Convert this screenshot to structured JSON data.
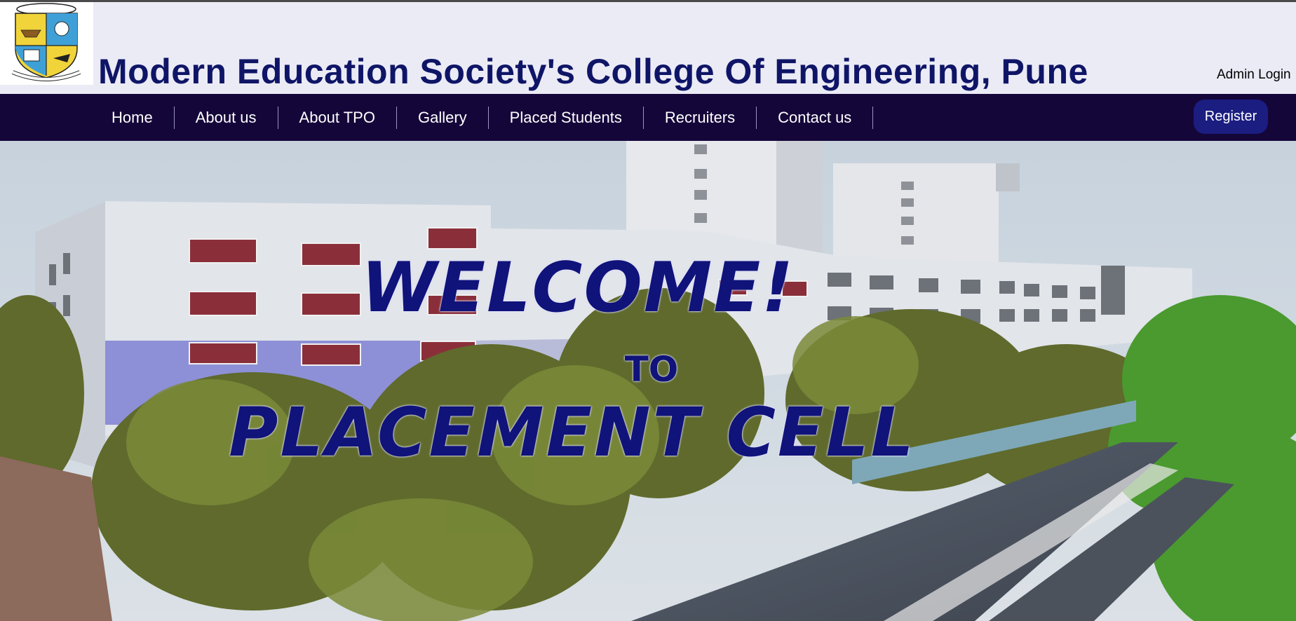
{
  "header": {
    "title": "Modern Education Society's College Of Engineering, Pune",
    "admin_login": "Admin Login",
    "logo_icon": "college-crest-logo"
  },
  "nav": {
    "items": [
      "Home",
      "About us",
      "About TPO",
      "Gallery",
      "Placed Students",
      "Recruiters",
      "Contact us"
    ],
    "register_label": "Register"
  },
  "hero": {
    "line1": "WELCOME!",
    "line2": "TO",
    "line3": "PLACEMENT CELL"
  },
  "colors": {
    "title": "#0f1566",
    "navbar": "#15063a",
    "register": "#1b1d80",
    "hero_text": "#10137a"
  }
}
